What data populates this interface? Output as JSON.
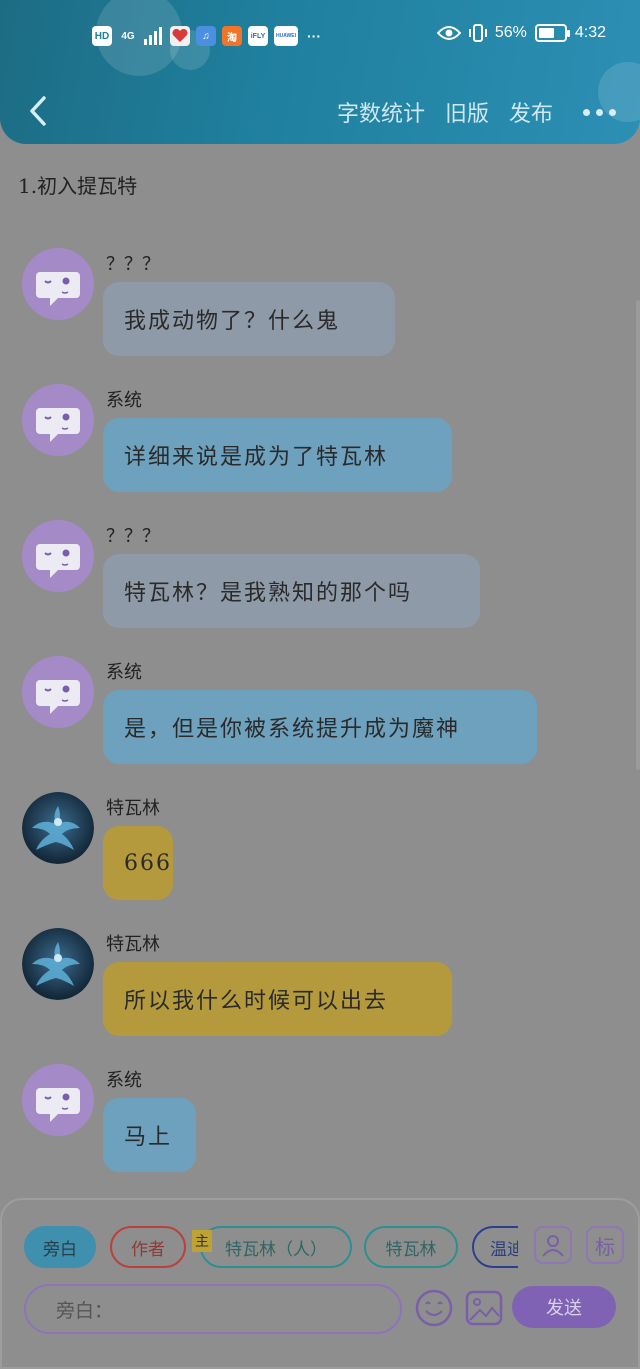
{
  "status_bar": {
    "left_icons": [
      "HD",
      "4G",
      "signal-icon",
      "app-icon-red",
      "app-icon-blue",
      "淘",
      "iFLY",
      "HUAWEI",
      "···"
    ],
    "battery": "56%",
    "time": "4:32"
  },
  "nav": {
    "actions": [
      "字数统计",
      "旧版",
      "发布"
    ]
  },
  "chapter_title": "1.初入提瓦特",
  "messages": [
    {
      "sender": "？？？",
      "text": "我成动物了？什么鬼",
      "style": "gray",
      "avatar": "system"
    },
    {
      "sender": "系统",
      "text": "详细来说是成为了特瓦林",
      "style": "blue",
      "avatar": "system"
    },
    {
      "sender": "？？？",
      "text": "特瓦林？是我熟知的那个吗",
      "style": "gray",
      "avatar": "system"
    },
    {
      "sender": "系统",
      "text": "是，但是你被系统提升成为魔神",
      "style": "blue",
      "avatar": "system"
    },
    {
      "sender": "特瓦林",
      "text": "666",
      "style": "yellow",
      "avatar": "dragon"
    },
    {
      "sender": "特瓦林",
      "text": "所以我什么时候可以出去",
      "style": "yellow",
      "avatar": "dragon"
    },
    {
      "sender": "系统",
      "text": "马上",
      "style": "blue",
      "avatar": "system"
    }
  ],
  "roles": [
    {
      "label": "旁白",
      "active": true
    },
    {
      "label": "作者"
    },
    {
      "label": "特瓦林（人）"
    },
    {
      "label": "特瓦林"
    },
    {
      "label": "温迪"
    }
  ],
  "main_tag": "主",
  "tag_button": "标",
  "input": {
    "placeholder": "旁白："
  },
  "send_label": "发送",
  "colors": {
    "header": "#1f7f9d",
    "bubble_gray": "#8f9aa8",
    "bubble_blue": "#6ea1bd",
    "bubble_yellow": "#b49a3c",
    "accent_purple": "#7f62b3"
  }
}
